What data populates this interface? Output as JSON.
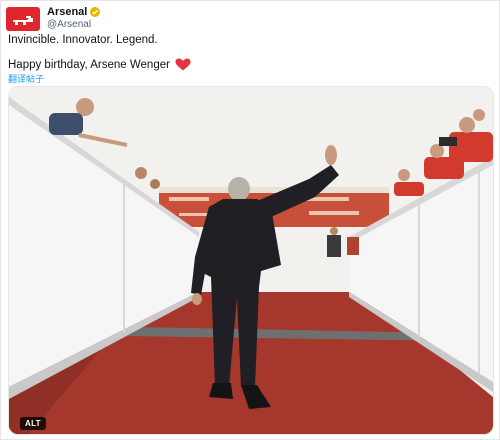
{
  "account": {
    "name": "Arsenal",
    "handle": "@Arsenal",
    "verified_badge_color": "#e6b800",
    "brand_color": "#e0262d"
  },
  "tweet": {
    "line1": "Invincible. Innovator. Legend.",
    "line2": "Happy birthday, Arsene Wenger",
    "translate_label": "翻译帖子",
    "link_color": "#1d9bf0"
  },
  "media": {
    "alt_label": "ALT"
  },
  "icons": {
    "verified": "verified-badge-icon",
    "heart": "red-heart-icon",
    "crest": "arsenal-crest-icon"
  }
}
